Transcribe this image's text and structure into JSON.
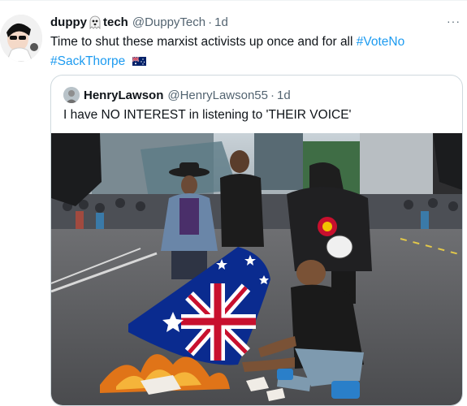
{
  "tweet": {
    "author_name_part1": "duppy",
    "author_name_part2": "tech",
    "handle": "@DuppyTech",
    "separator": "·",
    "time": "1d",
    "more_label": "···",
    "text_main": "Time to shut these marxist activists up once and for all ",
    "hashtag1": "#VoteNo",
    "hashtag2": "#SackThorpe"
  },
  "quoted_tweet": {
    "author_name": "HenryLawson",
    "handle": "@HenryLawson55",
    "separator": "·",
    "time": "1d",
    "text": "I have NO INTEREST in listening to 'THEIR VOICE'"
  },
  "colors": {
    "link": "#1d9bf0",
    "secondary_text": "#536471",
    "border": "#cfd9de"
  },
  "icons": [
    "ghost-emoji-icon",
    "australian-flag-emoji-icon",
    "more-options-icon"
  ]
}
